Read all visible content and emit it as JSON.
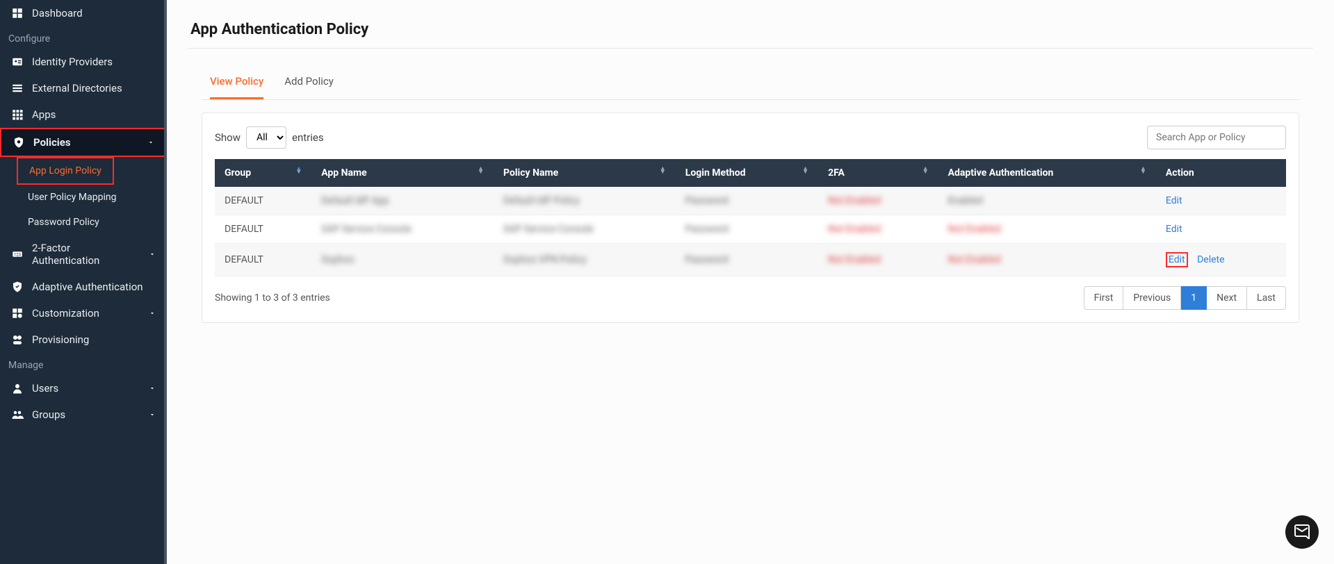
{
  "sidebar": {
    "dashboard": "Dashboard",
    "section_configure": "Configure",
    "identity_providers": "Identity Providers",
    "external_directories": "External Directories",
    "apps": "Apps",
    "policies": "Policies",
    "policies_sub": {
      "app_login": "App Login Policy",
      "user_policy_mapping": "User Policy Mapping",
      "password_policy": "Password Policy"
    },
    "two_factor": "2-Factor Authentication",
    "adaptive_auth": "Adaptive Authentication",
    "customization": "Customization",
    "provisioning": "Provisioning",
    "section_manage": "Manage",
    "users": "Users",
    "groups": "Groups"
  },
  "page": {
    "title": "App Authentication Policy"
  },
  "tabs": {
    "view": "View Policy",
    "add": "Add Policy"
  },
  "toolbar": {
    "show_label": "Show",
    "entries_label": "entries",
    "select_value": "All",
    "search_placeholder": "Search App or Policy"
  },
  "table": {
    "headers": {
      "group": "Group",
      "app_name": "App Name",
      "policy_name": "Policy Name",
      "login_method": "Login Method",
      "tfa": "2FA",
      "adaptive_auth": "Adaptive Authentication",
      "action": "Action"
    },
    "rows": [
      {
        "group": "DEFAULT",
        "app_name": "Default IdP App",
        "policy_name": "Default IdP Policy",
        "login_method": "Password",
        "tfa": "Not Enabled",
        "adaptive": "Enabled",
        "actions": [
          "Edit"
        ]
      },
      {
        "group": "DEFAULT",
        "app_name": "SAP Service Console",
        "policy_name": "SAP Service Console",
        "login_method": "Password",
        "tfa": "Not Enabled",
        "adaptive": "Not Enabled",
        "actions": [
          "Edit"
        ]
      },
      {
        "group": "DEFAULT",
        "app_name": "Sophos",
        "policy_name": "Sophos VPN Policy",
        "login_method": "Password",
        "tfa": "Not Enabled",
        "adaptive": "Not Enabled",
        "actions": [
          "Edit",
          "Delete"
        ]
      }
    ],
    "footer_text": "Showing 1 to 3 of 3 entries"
  },
  "pager": {
    "first": "First",
    "previous": "Previous",
    "page": "1",
    "next": "Next",
    "last": "Last"
  }
}
